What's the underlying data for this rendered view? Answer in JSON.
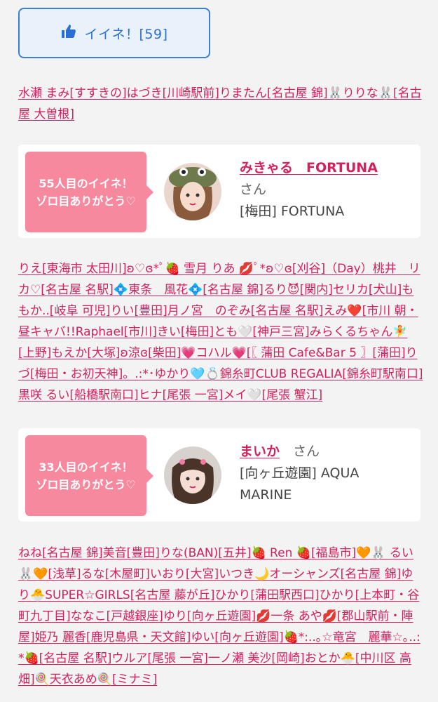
{
  "like_button": {
    "label": "イイネ！[59]",
    "icon": "thumbs-up-icon"
  },
  "colors": {
    "link": "#d4215c",
    "bubble": "#f7899f",
    "button_border": "#3d7ed8",
    "button_text": "#2a6fd1"
  },
  "list1": [
    "水瀬 まみ[すすきの]",
    "はづき[川崎駅前]",
    "りまたん[名古屋 錦]",
    "🐰りりな🐰[名古屋 大曽根]"
  ],
  "card1": {
    "milestone": "55人目のイイネ！\nゾロ目ありがとう♡",
    "name": "みきゃる　FORTUNA",
    "honorific": "さん",
    "shop": "[梅田] FORTUNA"
  },
  "list2": [
    "りえ[東海市 太田川]",
    "ʚ♡ɞ*ﾟ🍓 雪月 りあ 💋ﾟ*ʚ♡ɞ[刈谷]",
    "（Day）桃井　リカ♡[名古屋 名駅]",
    "💠東条　風花💠[名古屋 錦]",
    "るり😈[関内]",
    "セリカ[犬山]",
    "ももか..[岐阜 可児]",
    "りい[豊田]",
    "月ノ宮　のぞみ[名古屋 名駅]",
    "えみ❤️[市川 朝・昼キャバ!!Raphael[市川]",
    "きい[梅田]",
    "とも🤍[神戸三宮]",
    "みらくるちゃん🧚[上野]",
    "もえか[大塚]",
    "ʚ涼ɞ[柴田]",
    "💗コハル💗[〖 蒲田 Cafe&Bar 5 〗[蒲田]",
    "りづ[梅田・お初天神]",
    "。.:*･ゆかり🩵💍錦糸町CLUB REGALIA[錦糸町駅南口]",
    "黒咲 るい[船橋駅南口]",
    "ヒナ[尾張 一宮]",
    "メイ🤍[尾張 蟹江]"
  ],
  "card2": {
    "milestone": "33人目のイイネ！\nゾロ目ありがとう♡",
    "name": "まいか",
    "honorific": "さん",
    "shop": "[向ヶ丘遊園] AQUA MARINE"
  },
  "list3": [
    "ねね[名古屋 錦]",
    "美音[豊田]",
    "りな(BAN)[五井]",
    "🍓 Ren 🍓[福島市]",
    "🧡🐰 るい 🐰🧡[浅草]",
    "るな[木屋町]",
    "いおり[大宮]",
    "いつき🌙オーシャンズ[名古屋 錦]",
    "ゆり🐣SUPER☆GIRLS[名古屋 藤が丘]",
    "ひかり[蒲田駅西口]",
    "ひかり[上本町・谷町九丁目]",
    "ななこ[戸越銀座]",
    "ゆり[向ヶ丘遊園]",
    "💋一条 あや💋[郡山駅前・陣屋]",
    "姫乃 麗香[鹿児島県・天文館]",
    "ゆい[向ヶ丘遊園]",
    "🍓*:..｡☆竜宮　麗華☆｡..:*🍓[名古屋 名駅]",
    "ウルア[尾張 一宮]",
    "一ノ瀬 美沙[岡崎]",
    "おとか🐣[中川区 高畑]",
    "🍭天衣あめ🍭[ミナミ]"
  ]
}
